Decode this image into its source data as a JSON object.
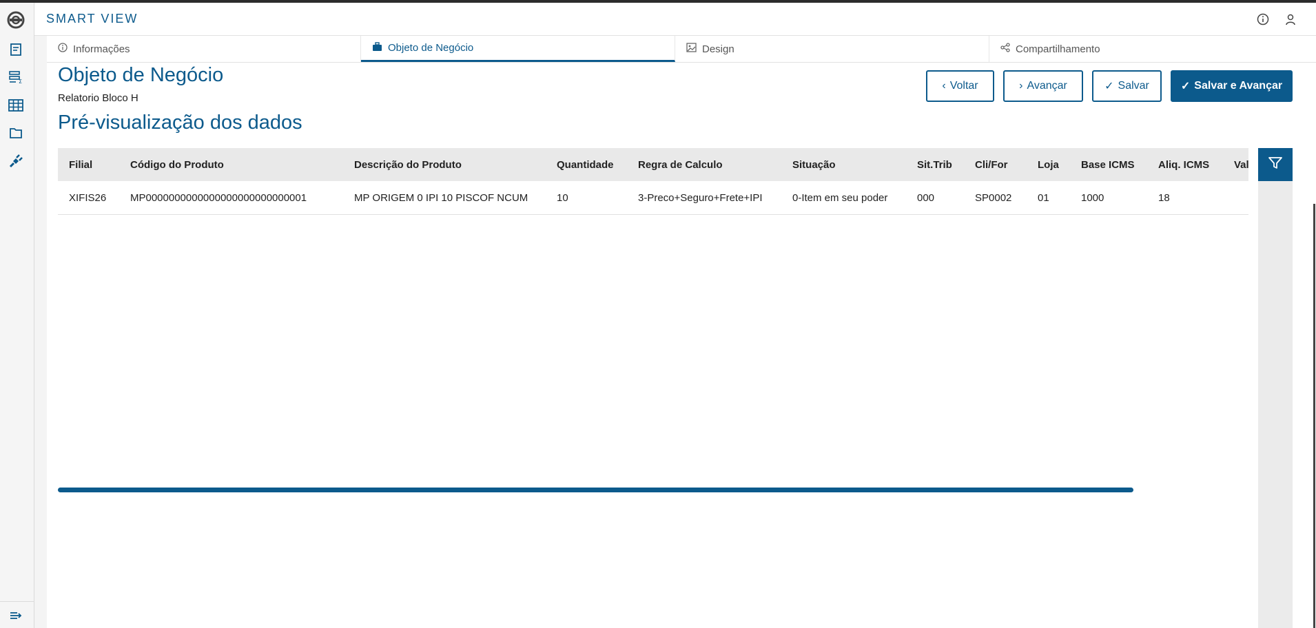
{
  "header": {
    "app_title": "SMART VIEW"
  },
  "rail": {
    "icons": [
      "totvs-logo-icon",
      "report-icon",
      "formula-list-icon",
      "table-icon",
      "folder-icon",
      "plugin-icon",
      "collapse-menu-icon"
    ]
  },
  "tabs": [
    {
      "label": "Informações",
      "icon": "info-icon",
      "active": false
    },
    {
      "label": "Objeto de Negócio",
      "icon": "briefcase-icon",
      "active": true
    },
    {
      "label": "Design",
      "icon": "image-icon",
      "active": false
    },
    {
      "label": "Compartilhamento",
      "icon": "share-icon",
      "active": false
    }
  ],
  "page": {
    "title": "Objeto de Negócio",
    "subtitle": "Relatorio Bloco H",
    "section_title": "Pré-visualização dos dados"
  },
  "buttons": {
    "back": "Voltar",
    "next": "Avançar",
    "save": "Salvar",
    "save_next": "Salvar e Avançar"
  },
  "table": {
    "columns": [
      "Filial",
      "Código do Produto",
      "Descrição do Produto",
      "Quantidade",
      "Regra de Calculo",
      "Situação",
      "Sit.Trib",
      "Cli/For",
      "Loja",
      "Base ICMS",
      "Aliq. ICMS",
      "Valor ICMS"
    ],
    "rows": [
      [
        "XIFIS26",
        "MP0000000000000000000000000001",
        "MP ORIGEM 0 IPI 10 PISCOF NCUM",
        "10",
        "3-Preco+Seguro+Frete+IPI",
        "0-Item em seu poder",
        "000",
        "SP0002",
        "01",
        "1000",
        "18",
        ""
      ]
    ]
  },
  "colors": {
    "brand": "#0c5a8c",
    "header_row": "#e9e9e9"
  }
}
